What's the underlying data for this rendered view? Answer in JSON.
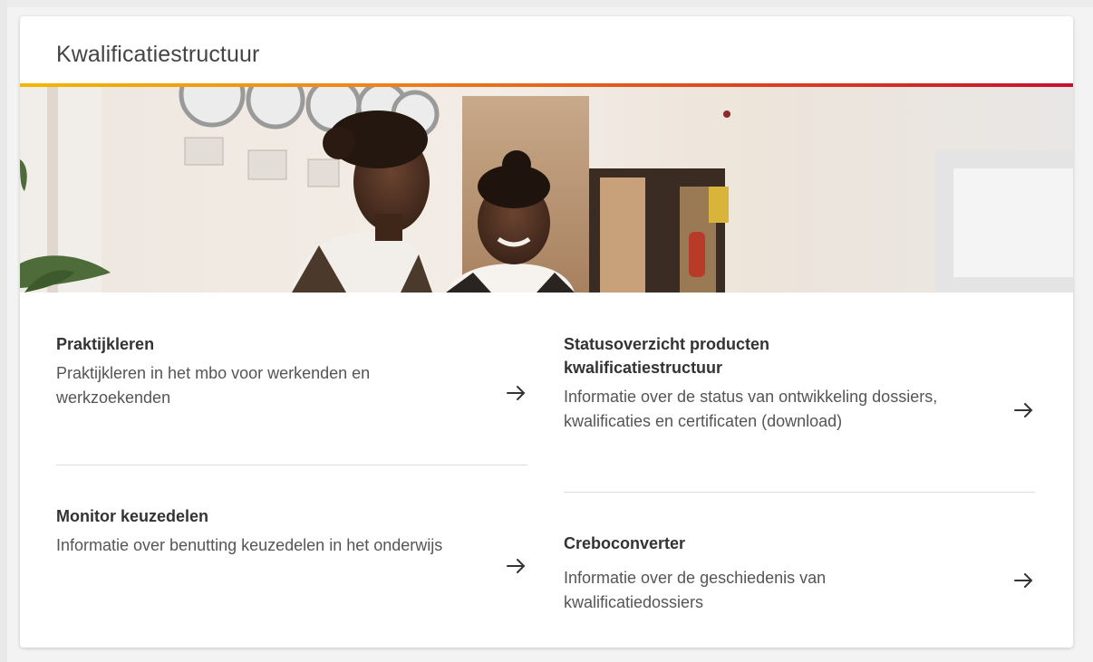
{
  "card": {
    "title": "Kwalificatiestructuur"
  },
  "links": [
    {
      "title": "Praktijkleren",
      "desc": "Praktijkleren in het mbo voor werkenden en werkzoekenden",
      "icon": "arrow-right-icon"
    },
    {
      "title": "Monitor keuzedelen",
      "desc": "Informatie over benutting keuzedelen in het onderwijs",
      "icon": "arrow-right-icon"
    },
    {
      "title": "Statusoverzicht producten kwalificatiestructuur",
      "desc": "Informatie over de status van ontwikkeling dossiers, kwalificaties en certificaten (download)",
      "icon": "arrow-right-icon"
    },
    {
      "title": "Creboconverter",
      "desc": "Informatie over de geschiedenis van kwalificatiedossiers",
      "icon": "arrow-right-icon"
    }
  ],
  "colors": {
    "gradient_start": "#f2b705",
    "gradient_end": "#c8102e",
    "title_text": "#444444",
    "body_text": "#555555"
  }
}
